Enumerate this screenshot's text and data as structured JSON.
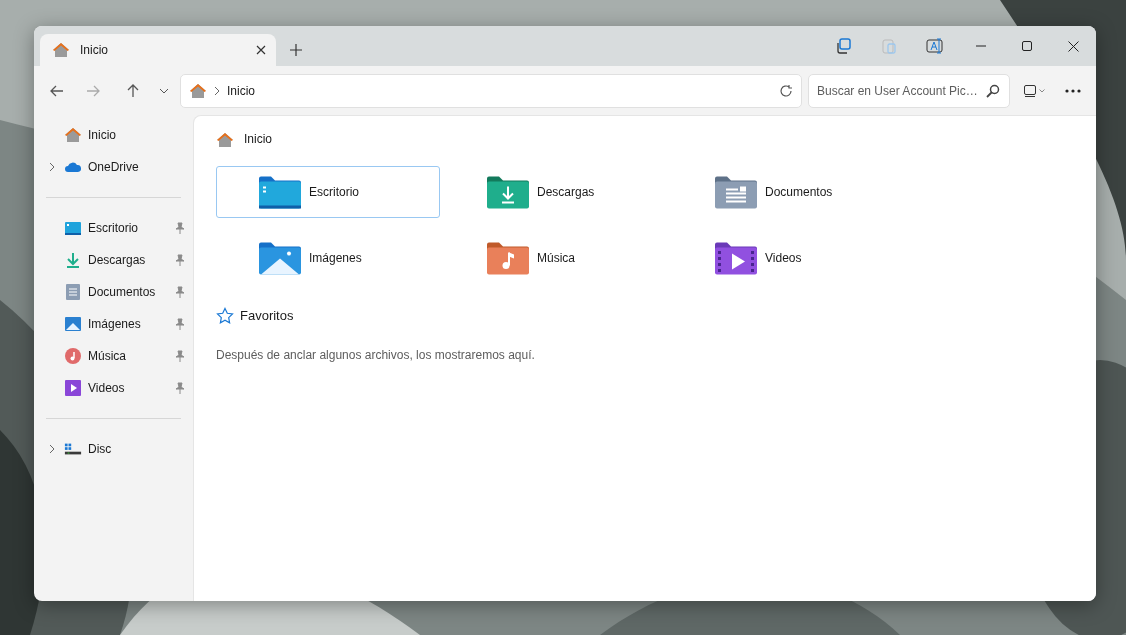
{
  "window": {
    "tabs": [
      {
        "label": "Inicio",
        "selected": true
      }
    ]
  },
  "address_bar": {
    "path": [
      "Inicio"
    ]
  },
  "search": {
    "placeholder": "Buscar en User Account Pic…"
  },
  "sidebar": {
    "groups": [
      {
        "items": [
          {
            "label": "Inicio",
            "kind": "home",
            "expandable": false,
            "pinned": false
          },
          {
            "label": "OneDrive",
            "kind": "cloud",
            "expandable": true,
            "pinned": false
          }
        ]
      },
      {
        "items": [
          {
            "label": "Escritorio",
            "kind": "desktop",
            "expandable": false,
            "pinned": true
          },
          {
            "label": "Descargas",
            "kind": "downloads",
            "expandable": false,
            "pinned": true
          },
          {
            "label": "Documentos",
            "kind": "documents",
            "expandable": false,
            "pinned": true
          },
          {
            "label": "Imágenes",
            "kind": "pictures",
            "expandable": false,
            "pinned": true
          },
          {
            "label": "Música",
            "kind": "music",
            "expandable": false,
            "pinned": true
          },
          {
            "label": "Videos",
            "kind": "videos",
            "expandable": false,
            "pinned": true
          }
        ]
      },
      {
        "items": [
          {
            "label": "Disc",
            "kind": "drive",
            "expandable": true,
            "pinned": false
          }
        ]
      }
    ]
  },
  "content": {
    "heading": "Inicio",
    "folders": [
      {
        "label": "Escritorio",
        "kind": "desktop",
        "selected": true
      },
      {
        "label": "Descargas",
        "kind": "downloads",
        "selected": false
      },
      {
        "label": "Documentos",
        "kind": "documents",
        "selected": false
      },
      {
        "label": "Imágenes",
        "kind": "pictures",
        "selected": false
      },
      {
        "label": "Música",
        "kind": "music",
        "selected": false
      },
      {
        "label": "Videos",
        "kind": "videos",
        "selected": false
      }
    ],
    "favorites": {
      "heading": "Favoritos",
      "empty_message": "Después de anclar algunos archivos, los mostraremos aquí."
    }
  }
}
